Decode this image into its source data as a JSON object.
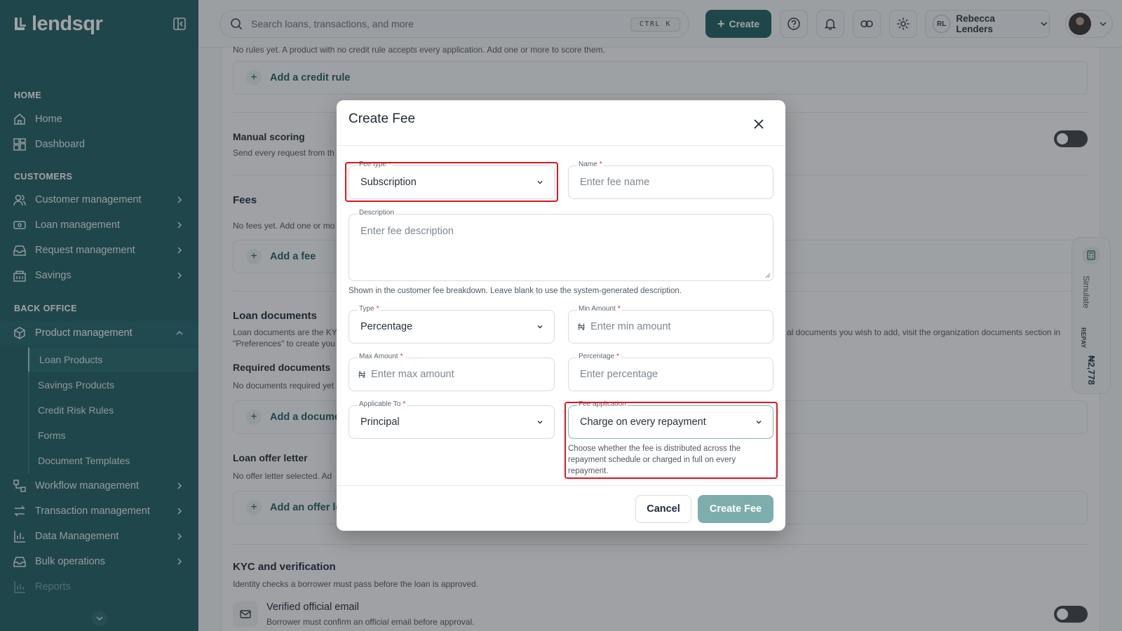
{
  "app": {
    "brand": "lendsqr"
  },
  "sidebar": {
    "sections": [
      {
        "title": "HOME"
      },
      {
        "title": "CUSTOMERS"
      },
      {
        "title": "BACK OFFICE"
      }
    ],
    "items": [
      {
        "label": "Home",
        "icon": "home-icon"
      },
      {
        "label": "Dashboard",
        "icon": "dashboard-icon"
      },
      {
        "label": "Customer management",
        "icon": "users-icon"
      },
      {
        "label": "Loan management",
        "icon": "loan-icon"
      },
      {
        "label": "Request management",
        "icon": "inbox-icon"
      },
      {
        "label": "Savings",
        "icon": "savings-icon"
      },
      {
        "label": "Product management",
        "icon": "box-icon"
      },
      {
        "label": "Workflow management",
        "icon": "workflow-icon"
      },
      {
        "label": "Transaction management",
        "icon": "transfer-icon"
      },
      {
        "label": "Data Management",
        "icon": "chart-icon"
      },
      {
        "label": "Bulk operations",
        "icon": "inbox-icon"
      },
      {
        "label": "Reports",
        "icon": "reports-icon"
      }
    ],
    "sub_items": [
      {
        "label": "Loan Products"
      },
      {
        "label": "Savings Products"
      },
      {
        "label": "Credit Risk Rules"
      },
      {
        "label": "Forms"
      },
      {
        "label": "Document Templates"
      }
    ]
  },
  "topbar": {
    "search_placeholder": "Search loans, transactions, and more",
    "shortcut": "CTRL K",
    "create_label": "Create",
    "user_initials": "RL",
    "user_name": "Rebecca Lenders"
  },
  "page": {
    "credit_rules_note": "No rules yet. A product with no credit rule accepts every application. Add one or more to score them.",
    "add_credit_rule": "Add a credit rule",
    "manual_scoring_title": "Manual scoring",
    "manual_scoring_desc": "Send every request from th",
    "fees_title": "Fees",
    "fees_desc": "No fees yet. Add one or mo",
    "add_fee": "Add a fee",
    "loan_documents_title": "Loan documents",
    "loan_documents_desc_1": "Loan documents are the KY",
    "loan_documents_desc_2": "\"Preferences\" to create you",
    "loan_documents_desc_right": "al documents you wish to add, visit the organization documents section in",
    "required_documents_title": "Required documents",
    "required_documents_desc": "No documents required yet",
    "add_document": "Add a docume",
    "offer_letter_title": "Loan offer letter",
    "offer_letter_desc": "No offer letter selected. Ad",
    "add_offer_letter": "Add an offer le",
    "kyc_title": "KYC and verification",
    "kyc_desc": "Identity checks a borrower must pass before the loan is approved.",
    "verified_email_title": "Verified official email",
    "verified_email_desc": "Borrower must confirm an official email before approval."
  },
  "simulate": {
    "label": "Simulate",
    "repay_label": "REPAY",
    "repay_value": "₦2,778"
  },
  "modal": {
    "title": "Create Fee",
    "fee_type": {
      "label": "Fee type",
      "value": "Subscription"
    },
    "name": {
      "label": "Name",
      "placeholder": "Enter fee name"
    },
    "description": {
      "label": "Description",
      "placeholder": "Enter fee description",
      "hint": "Shown in the customer fee breakdown. Leave blank to use the system-generated description."
    },
    "type": {
      "label": "Type",
      "value": "Percentage"
    },
    "min_amount": {
      "label": "Min Amount",
      "currency": "₦",
      "placeholder": "Enter min amount"
    },
    "max_amount": {
      "label": "Max Amount",
      "currency": "₦",
      "placeholder": "Enter max amount"
    },
    "percentage": {
      "label": "Percentage",
      "placeholder": "Enter percentage"
    },
    "applicable_to": {
      "label": "Applicable To",
      "value": "Principal"
    },
    "fee_application": {
      "label": "Fee application",
      "value": "Charge on every repayment",
      "hint": "Choose whether the fee is distributed across the repayment schedule or charged in full on every repayment."
    },
    "cancel_label": "Cancel",
    "create_label": "Create Fee"
  },
  "colors": {
    "sidebar_bg": "#1f5f63",
    "accent": "#1f5f63",
    "highlight": "#e0141e",
    "required": "#d9262b"
  }
}
